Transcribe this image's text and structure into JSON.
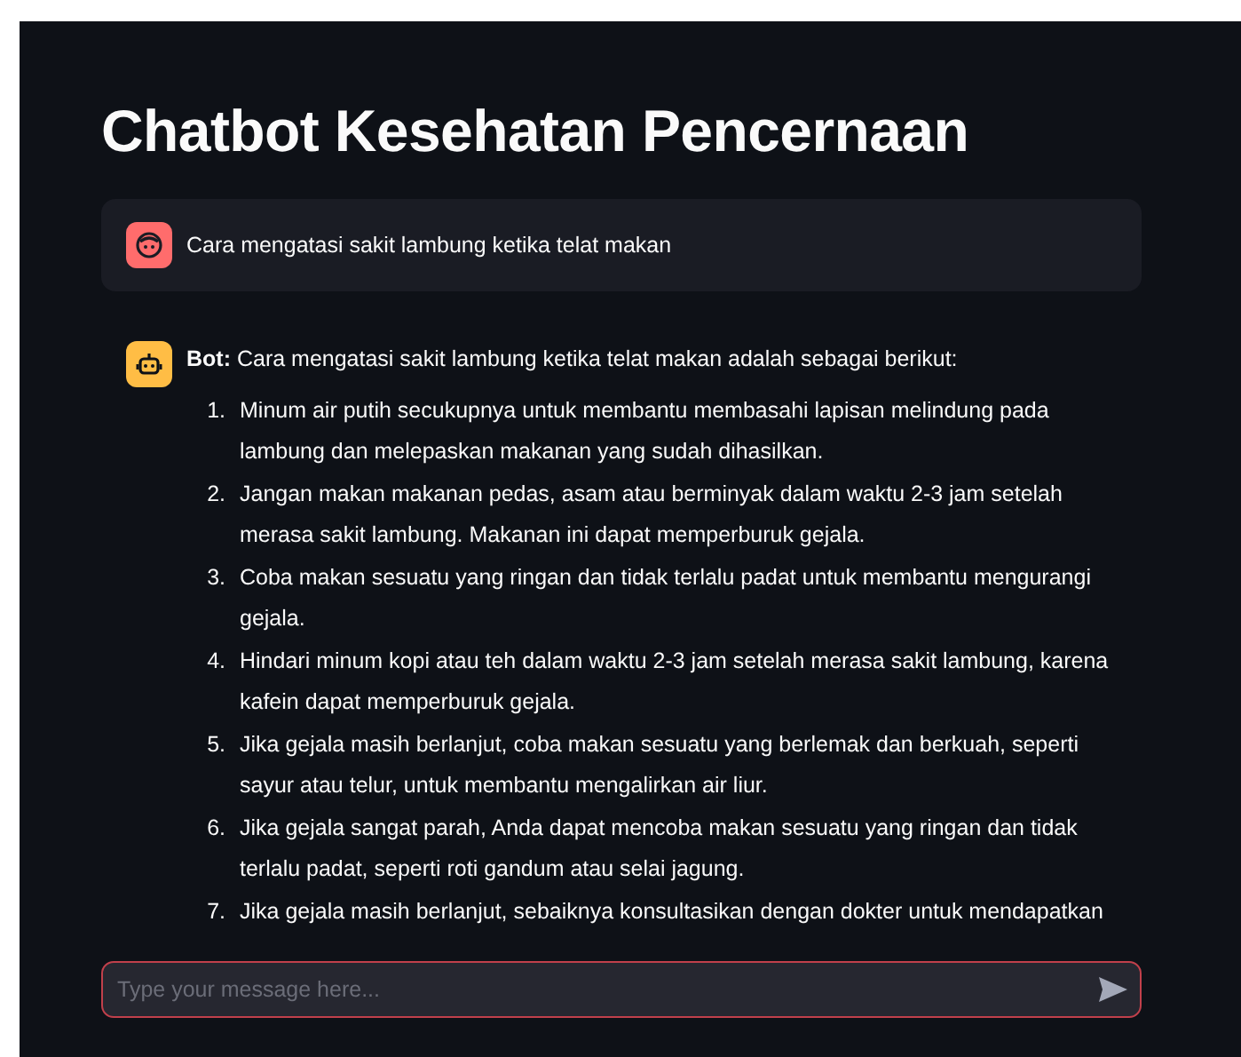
{
  "title": "Chatbot Kesehatan Pencernaan",
  "messages": [
    {
      "kind": "user",
      "text": "Cara mengatasi sakit lambung ketika telat makan"
    },
    {
      "kind": "bot",
      "text": "**Bot:** Cara mengatasi sakit lambung ketika telat makan adalah sebagai berikut:",
      "items": [
        {
          "number": "1.",
          "text": "Minum air putih secukupnya untuk membantu membasahi lapisan melindung pada lambung dan melepaskan makanan yang sudah dihasilkan."
        },
        {
          "number": "2.",
          "text": "Jangan makan makanan pedas, asam atau berminyak dalam waktu 2-3 jam setelah merasa sakit lambung. Makanan ini dapat memperburuk gejala."
        },
        {
          "number": "3.",
          "text": "Coba makan sesuatu yang ringan dan tidak terlalu padat untuk membantu mengurangi gejala."
        },
        {
          "number": "4.",
          "text": "Hindari minum kopi atau teh dalam waktu 2-3 jam setelah merasa sakit lambung, karena kafein dapat memperburuk gejala."
        },
        {
          "number": "5.",
          "text": "Jika gejala masih berlanjut, coba makan sesuatu yang berlemak dan berkuah, seperti sayur atau telur, untuk membantu mengalirkan air liur."
        },
        {
          "number": "6.",
          "text": "Jika gejala sangat parah, Anda dapat mencoba makan sesuatu yang ringan dan tidak terlalu padat, seperti roti gandum atau selai jagung."
        },
        {
          "number": "7.",
          "text": "Jika gejala masih berlanjut, sebaiknya konsultasikan dengan dokter untuk mendapatkan"
        }
      ]
    }
  ],
  "input": {
    "placeholder": "Type your message here..."
  }
}
